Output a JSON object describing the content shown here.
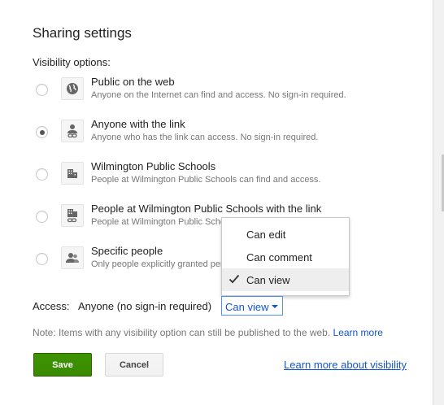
{
  "dialog": {
    "title": "Sharing settings",
    "visibility_label": "Visibility options:"
  },
  "options": [
    {
      "title": "Public on the web",
      "description": "Anyone on the Internet can find and access. No sign-in required.",
      "icon": "globe-icon",
      "selected": false
    },
    {
      "title": "Anyone with the link",
      "description": "Anyone who has the link can access. No sign-in required.",
      "icon": "person-link-icon",
      "selected": true
    },
    {
      "title": "Wilmington Public Schools",
      "description": "People at Wilmington Public Schools can find and access.",
      "icon": "building-icon",
      "selected": false
    },
    {
      "title": "People at Wilmington Public Schools with the link",
      "description": "People at Wilmington Public Schools",
      "icon": "building-link-icon",
      "selected": false
    },
    {
      "title": "Specific people",
      "description": "Only people explicitly granted per",
      "icon": "people-icon",
      "selected": false
    }
  ],
  "access": {
    "label": "Access:",
    "value": "Anyone (no sign-in required)",
    "dropdown_value": "Can view"
  },
  "menu": {
    "items": [
      {
        "label": "Can edit",
        "checked": false
      },
      {
        "label": "Can comment",
        "checked": false
      },
      {
        "label": "Can view",
        "checked": true
      }
    ]
  },
  "note": {
    "text": "Note: Items with any visibility option can still be published to the web.",
    "link": "Learn more"
  },
  "buttons": {
    "save": "Save",
    "cancel": "Cancel"
  },
  "learn_more_visibility": "Learn more about visibility",
  "colors": {
    "save_green": "#3d9400",
    "link_blue": "#1155cc",
    "focus_blue": "#4d90fe"
  }
}
